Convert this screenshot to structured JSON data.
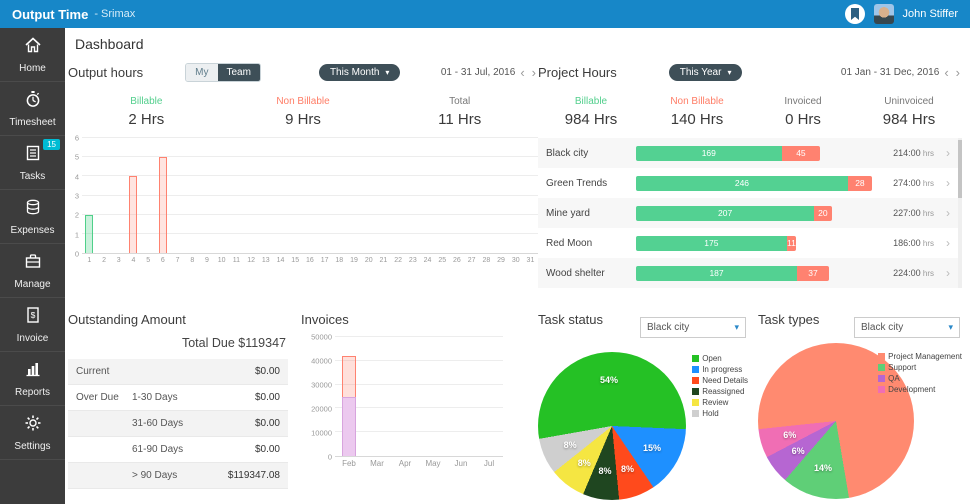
{
  "topbar": {
    "title": "Output Time",
    "subtitle": "- Srimax",
    "user_name": "John Stiffer"
  },
  "sidebar": {
    "items": [
      {
        "id": "home",
        "label": "Home"
      },
      {
        "id": "timesheet",
        "label": "Timesheet"
      },
      {
        "id": "tasks",
        "label": "Tasks",
        "badge": "15"
      },
      {
        "id": "expenses",
        "label": "Expenses"
      },
      {
        "id": "manage",
        "label": "Manage"
      },
      {
        "id": "invoice",
        "label": "Invoice"
      },
      {
        "id": "reports",
        "label": "Reports"
      },
      {
        "id": "settings",
        "label": "Settings"
      }
    ]
  },
  "page_title": "Dashboard",
  "output_hours": {
    "title": "Output hours",
    "toggle_my": "My",
    "toggle_team": "Team",
    "period": "This Month",
    "date_range": "01 - 31 Jul, 2016",
    "prev": "‹",
    "next": "›",
    "stats": [
      {
        "label": "Billable",
        "value": "2 Hrs",
        "color": "#53cf8d"
      },
      {
        "label": "Non Billable",
        "value": "9 Hrs",
        "color": "#ff7d66"
      },
      {
        "label": "Total",
        "value": "11 Hrs",
        "color": "#777777"
      }
    ]
  },
  "project_hours": {
    "title": "Project Hours",
    "period": "This Year",
    "date_range": "01 Jan - 31 Dec, 2016",
    "prev": "‹",
    "next": "›",
    "unit": "hrs",
    "stats": [
      {
        "label": "Billable",
        "value": "984 Hrs",
        "color": "#53cf8d"
      },
      {
        "label": "Non Billable",
        "value": "140 Hrs",
        "color": "#ff7d66"
      },
      {
        "label": "Invoiced",
        "value": "0 Hrs",
        "color": "#777777"
      },
      {
        "label": "Uninvoiced",
        "value": "984 Hrs",
        "color": "#777777"
      }
    ]
  },
  "outstanding": {
    "title": "Outstanding Amount",
    "total_due": "Total Due $119347",
    "rows": [
      {
        "group": "Current",
        "range": "",
        "amount": "$0.00"
      },
      {
        "group": "Over Due",
        "range": "1-30 Days",
        "amount": "$0.00"
      },
      {
        "group": "",
        "range": "31-60 Days",
        "amount": "$0.00"
      },
      {
        "group": "",
        "range": "61-90 Days",
        "amount": "$0.00"
      },
      {
        "group": "",
        "range": "> 90 Days",
        "amount": "$119347.08"
      }
    ]
  },
  "invoices": {
    "title": "Invoices"
  },
  "task_status": {
    "title": "Task status",
    "filter": "Black city"
  },
  "task_types": {
    "title": "Task types",
    "filter": "Black city"
  },
  "chart_data": [
    {
      "id": "output_hours_daily",
      "type": "bar",
      "title": "Output hours",
      "x": [
        1,
        2,
        3,
        4,
        5,
        6,
        7,
        8,
        9,
        10,
        11,
        12,
        13,
        14,
        15,
        16,
        17,
        18,
        19,
        20,
        21,
        22,
        23,
        24,
        25,
        26,
        27,
        28,
        29,
        30,
        31
      ],
      "series": [
        {
          "name": "Billable",
          "color": "#53cf8d",
          "values": [
            2,
            0,
            0,
            0,
            0,
            0,
            0,
            0,
            0,
            0,
            0,
            0,
            0,
            0,
            0,
            0,
            0,
            0,
            0,
            0,
            0,
            0,
            0,
            0,
            0,
            0,
            0,
            0,
            0,
            0,
            0
          ]
        },
        {
          "name": "Non Billable",
          "color": "#ff7d66",
          "values": [
            0,
            0,
            0,
            4,
            0,
            5,
            0,
            0,
            0,
            0,
            0,
            0,
            0,
            0,
            0,
            0,
            0,
            0,
            0,
            0,
            0,
            0,
            0,
            0,
            0,
            0,
            0,
            0,
            0,
            0,
            0
          ]
        }
      ],
      "ylim": [
        0,
        6
      ],
      "yticks": [
        0,
        1,
        2,
        3,
        4,
        5,
        6
      ]
    },
    {
      "id": "project_hours",
      "type": "bar",
      "orientation": "horizontal-stacked",
      "categories": [
        "Black city",
        "Green Trends",
        "Mine yard",
        "Red Moon",
        "Wood shelter"
      ],
      "series": [
        {
          "name": "Billable",
          "color": "#53d192",
          "values": [
            169,
            246,
            207,
            175,
            187
          ]
        },
        {
          "name": "Non Billable",
          "color": "#ff8270",
          "values": [
            45,
            28,
            20,
            11,
            37
          ]
        }
      ],
      "totals": [
        "214:00",
        "274:00",
        "227:00",
        "186:00",
        "224:00"
      ]
    },
    {
      "id": "invoices_monthly",
      "type": "bar",
      "title": "Invoices",
      "categories": [
        "Feb",
        "Mar",
        "Apr",
        "May",
        "Jun",
        "Jul"
      ],
      "series": [
        {
          "color": "#ecc9ef",
          "values": [
            25000,
            0,
            0,
            0,
            0,
            0
          ]
        },
        {
          "color": "#ff8270",
          "values": [
            17000,
            0,
            0,
            0,
            0,
            0
          ]
        }
      ],
      "ylim": [
        0,
        50000
      ],
      "yticks": [
        0,
        10000,
        20000,
        30000,
        40000,
        50000
      ]
    },
    {
      "id": "task_status_pie",
      "type": "pie",
      "title": "Task status",
      "start_deg": -100,
      "slices": [
        {
          "label": "Open",
          "pct": 54,
          "color": "#25c125",
          "show_pct": true
        },
        {
          "label": "In progress",
          "pct": 15,
          "color": "#1e90ff",
          "show_pct": true
        },
        {
          "label": "Need Details",
          "pct": 8,
          "color": "#ff4a1c",
          "show_pct": true
        },
        {
          "label": "Reassigned",
          "pct": 8,
          "color": "#1f4620",
          "show_pct": true
        },
        {
          "label": "Review",
          "pct": 8,
          "color": "#f5e642",
          "show_pct": true
        },
        {
          "label": "Hold",
          "pct": 8,
          "color": "#cfcfcf",
          "show_pct": true
        }
      ]
    },
    {
      "id": "task_types_pie",
      "type": "pie",
      "title": "Task types",
      "start_deg": -96,
      "slices": [
        {
          "label": "Project Management",
          "pct": 74,
          "color": "#ff8a70",
          "show_pct": false
        },
        {
          "label": "Support",
          "pct": 14,
          "color": "#5fcf77",
          "show_pct": true
        },
        {
          "label": "QA",
          "pct": 6,
          "color": "#b666d2",
          "show_pct": true
        },
        {
          "label": "Development",
          "pct": 6,
          "color": "#f06eb4",
          "show_pct": true
        }
      ]
    }
  ]
}
